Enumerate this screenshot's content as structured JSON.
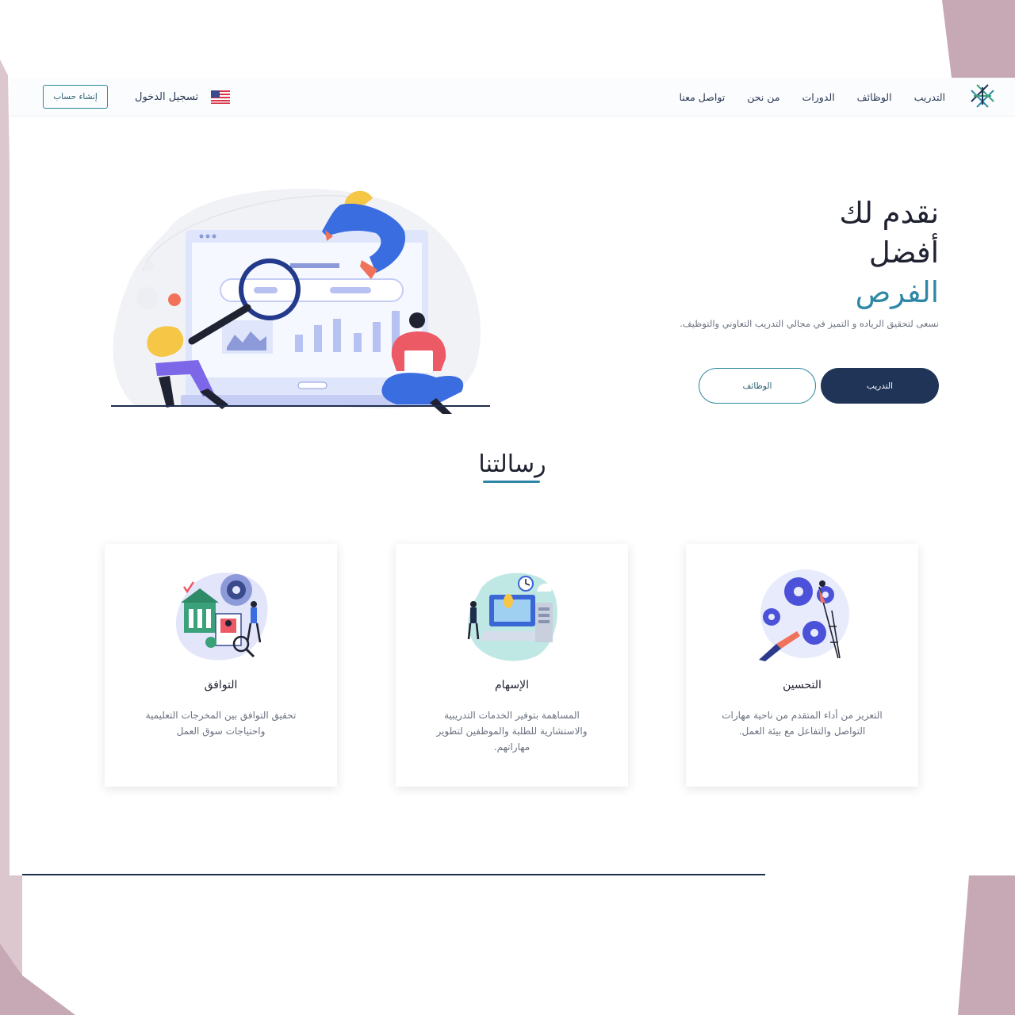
{
  "nav": {
    "links": [
      "التدريب",
      "الوظائف",
      "الدورات",
      "من نحن",
      "تواصل معنا"
    ],
    "login": "تسجيل الدخول",
    "register": "إنشاء حساب",
    "flag": "us-flag-icon"
  },
  "hero": {
    "title_line1": "نقدم لك",
    "title_line2": "أفضل",
    "title_line3": "الفرص",
    "subtitle": "نسعى لتحقيق الرياده و التميز في مجالي التدريب التعاوني والتوظيف.",
    "btn_primary": "التدريب",
    "btn_secondary": "الوظائف"
  },
  "mission": {
    "title": "رسالتنا",
    "cards": [
      {
        "title": "التحسين",
        "text": "التعزيز من أداء المتقدم من ناحية مهارات التواصل والتفاعل مع بيئة العمل."
      },
      {
        "title": "الإسهام",
        "text": "المساهمة بتوفير الخدمات التدريبية والاستشارية للطلبة والموظفين لتطوير مهاراتهم."
      },
      {
        "title": "التوافق",
        "text": "تحقيق التوافق بين المخرجات التعليمية واحتياجات سوق العمل"
      }
    ]
  },
  "colors": {
    "navy": "#1f3457",
    "teal": "#2f87a6",
    "frame": "#c7a9b5"
  }
}
